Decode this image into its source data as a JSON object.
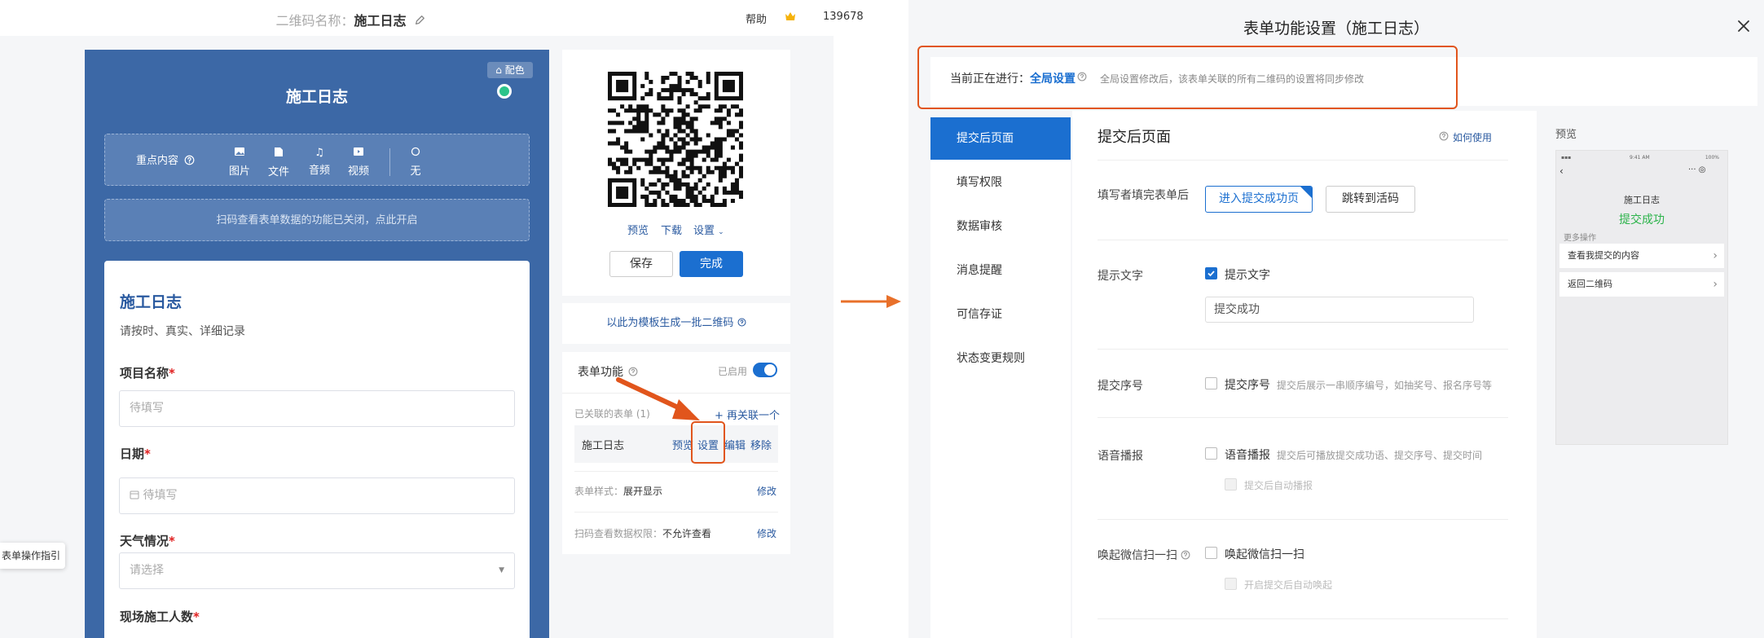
{
  "left_screen": {
    "qr_name_label": "二维码名称：",
    "qr_name": "施工日志",
    "help": "帮助",
    "phone": "139678",
    "palette_button": "配色",
    "form_header_title": "施工日志",
    "key_content": {
      "label": "重点内容",
      "items": [
        "图片",
        "文件",
        "音频",
        "视频",
        "无"
      ]
    },
    "scan_notice": "扫码查看表单数据的功能已关闭，点此开启",
    "form": {
      "title": "施工日志",
      "subtitle": "请按时、真实、详细记录",
      "fields": [
        {
          "label": "项目名称",
          "placeholder": "待填写"
        },
        {
          "label": "日期",
          "placeholder": "待填写"
        },
        {
          "label": "天气情况",
          "placeholder": "请选择"
        },
        {
          "label": "现场施工人数",
          "placeholder": ""
        }
      ],
      "required_mark": "*"
    },
    "guide_tooltip": "表单操作指引",
    "qr_actions": {
      "preview": "预览",
      "download": "下载",
      "settings": "设置"
    },
    "save_button": "保存",
    "done_button": "完成",
    "batch_generate": "以此为模板生成一批二维码",
    "form_function": {
      "title": "表单功能",
      "enabled_label": "已启用",
      "linked_forms": "已关联的表单 (1)",
      "link_more": "再关联一个",
      "linked_form_name": "施工日志",
      "row_actions": [
        "预览",
        "设置",
        "编辑",
        "移除"
      ],
      "style_label": "表单样式：",
      "style_value": "展开显示",
      "perm_label": "扫码查看数据权限：",
      "perm_value": "不允许查看",
      "edit": "修改"
    }
  },
  "right_screen": {
    "title": "表单功能设置（施工日志）",
    "hint_prefix": "当前正在进行：",
    "hint_mode": "全局设置",
    "hint_sub": "全局设置修改后，该表单关联的所有二维码的设置将同步修改",
    "menu": [
      "提交后页面",
      "填写权限",
      "数据审核",
      "消息提醒",
      "可信存证",
      "状态变更规则"
    ],
    "active_menu": 0,
    "content_title": "提交后页面",
    "how_to": "如何使用",
    "after_submit_label": "填写者填完表单后",
    "after_submit_options": [
      "进入提交成功页",
      "跳转到活码"
    ],
    "prompt_text_label": "提示文字",
    "prompt_text_checkbox": "提示文字",
    "prompt_text_value": "提交成功",
    "serial_label": "提交序号",
    "serial_checkbox": "提交序号",
    "serial_desc": "提交后展示一串顺序编号，如抽奖号、报名序号等",
    "voice_label": "语音播报",
    "voice_checkbox": "语音播报",
    "voice_desc": "提交后可播放提交成功语、提交序号、提交时间",
    "voice_auto": "提交后自动播报",
    "wechat_label": "唤起微信扫一扫",
    "wechat_checkbox": "唤起微信扫一扫",
    "wechat_auto": "开启提交后自动唤起",
    "preview": {
      "label": "预览",
      "status_time": "9:41 AM",
      "status_battery": "100%",
      "form_title": "施工日志",
      "success_text": "提交成功",
      "more_ops": "更多操作",
      "rows": [
        "查看我提交的内容",
        "返回二维码"
      ]
    }
  },
  "colors": {
    "brand_blue": "#1b6fd0",
    "panel_blue": "#3c68a6",
    "highlight_orange": "#e1551c",
    "success_green": "#2bb34a"
  }
}
